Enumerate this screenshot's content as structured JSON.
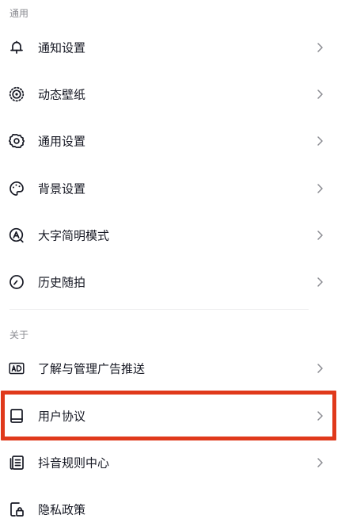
{
  "sections": {
    "general": {
      "header": "通用"
    },
    "about": {
      "header": "关于"
    }
  },
  "items": {
    "notification": {
      "label": "通知设置",
      "icon": "bell-icon"
    },
    "wallpaper": {
      "label": "动态壁纸",
      "icon": "live-wallpaper-icon"
    },
    "general_settings": {
      "label": "通用设置",
      "icon": "gear-icon"
    },
    "background": {
      "label": "背景设置",
      "icon": "palette-icon"
    },
    "large_text": {
      "label": "大字简明模式",
      "icon": "large-text-icon"
    },
    "history": {
      "label": "历史随拍",
      "icon": "history-clock-icon"
    },
    "ads": {
      "label": "了解与管理广告推送",
      "icon": "ad-icon"
    },
    "user_agreement": {
      "label": "用户协议",
      "icon": "book-icon"
    },
    "rules_center": {
      "label": "抖音规则中心",
      "icon": "rules-document-icon"
    },
    "privacy": {
      "label": "隐私政策",
      "icon": "privacy-lock-icon"
    }
  },
  "colors": {
    "text": "#161823",
    "secondary": "#8a8b91",
    "highlight_border": "#e0391b"
  }
}
